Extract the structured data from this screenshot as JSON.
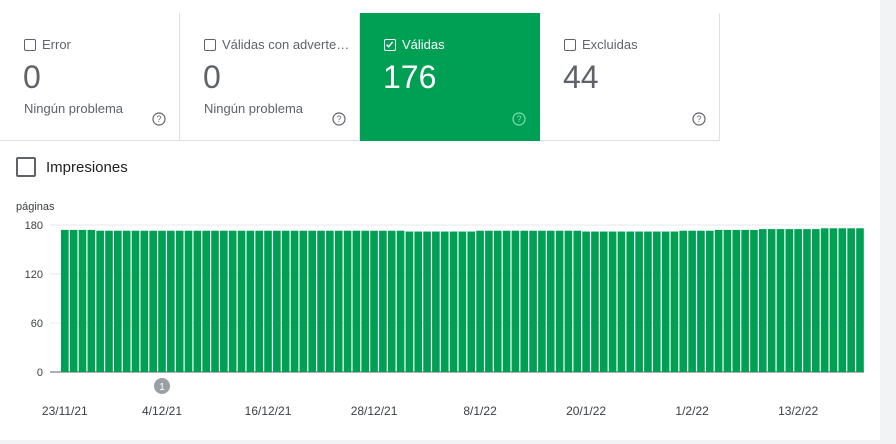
{
  "tiles": [
    {
      "label": "Error",
      "value": "0",
      "sub": "Ningún problema",
      "checked": false
    },
    {
      "label": "Válidas con advertencias",
      "value": "0",
      "sub": "Ningún problema",
      "checked": false
    },
    {
      "label": "Válidas",
      "value": "176",
      "sub": "",
      "checked": true
    },
    {
      "label": "Excluidas",
      "value": "44",
      "sub": "",
      "checked": false
    }
  ],
  "impressions_label": "Impresiones",
  "colors": {
    "valid": "#00a054",
    "grey": "#5f6368"
  },
  "chart_data": {
    "type": "bar",
    "ylabel": "páginas",
    "ylim": [
      0,
      180
    ],
    "yticks": [
      0,
      60,
      120,
      180
    ],
    "xtick_labels": [
      "23/11/21",
      "4/12/21",
      "16/12/21",
      "28/12/21",
      "8/1/22",
      "20/1/22",
      "1/2/22",
      "13/2/22"
    ],
    "xtick_index": [
      0,
      11,
      23,
      35,
      47,
      59,
      71,
      83
    ],
    "annotation": {
      "label": "1",
      "index": 11
    },
    "color": "#00a054",
    "values": [
      174,
      174,
      174,
      174,
      173,
      173,
      173,
      173,
      173,
      173,
      173,
      173,
      173,
      173,
      173,
      173,
      173,
      173,
      173,
      173,
      173,
      173,
      173,
      173,
      173,
      173,
      173,
      173,
      173,
      173,
      173,
      173,
      173,
      173,
      173,
      173,
      173,
      173,
      173,
      172,
      172,
      172,
      172,
      172,
      172,
      172,
      172,
      173,
      173,
      173,
      173,
      173,
      173,
      173,
      173,
      173,
      173,
      173,
      173,
      172,
      172,
      172,
      172,
      172,
      172,
      172,
      172,
      172,
      172,
      172,
      173,
      173,
      173,
      173,
      174,
      174,
      174,
      174,
      174,
      175,
      175,
      175,
      175,
      175,
      175,
      175,
      176,
      176,
      176,
      176,
      176
    ]
  }
}
